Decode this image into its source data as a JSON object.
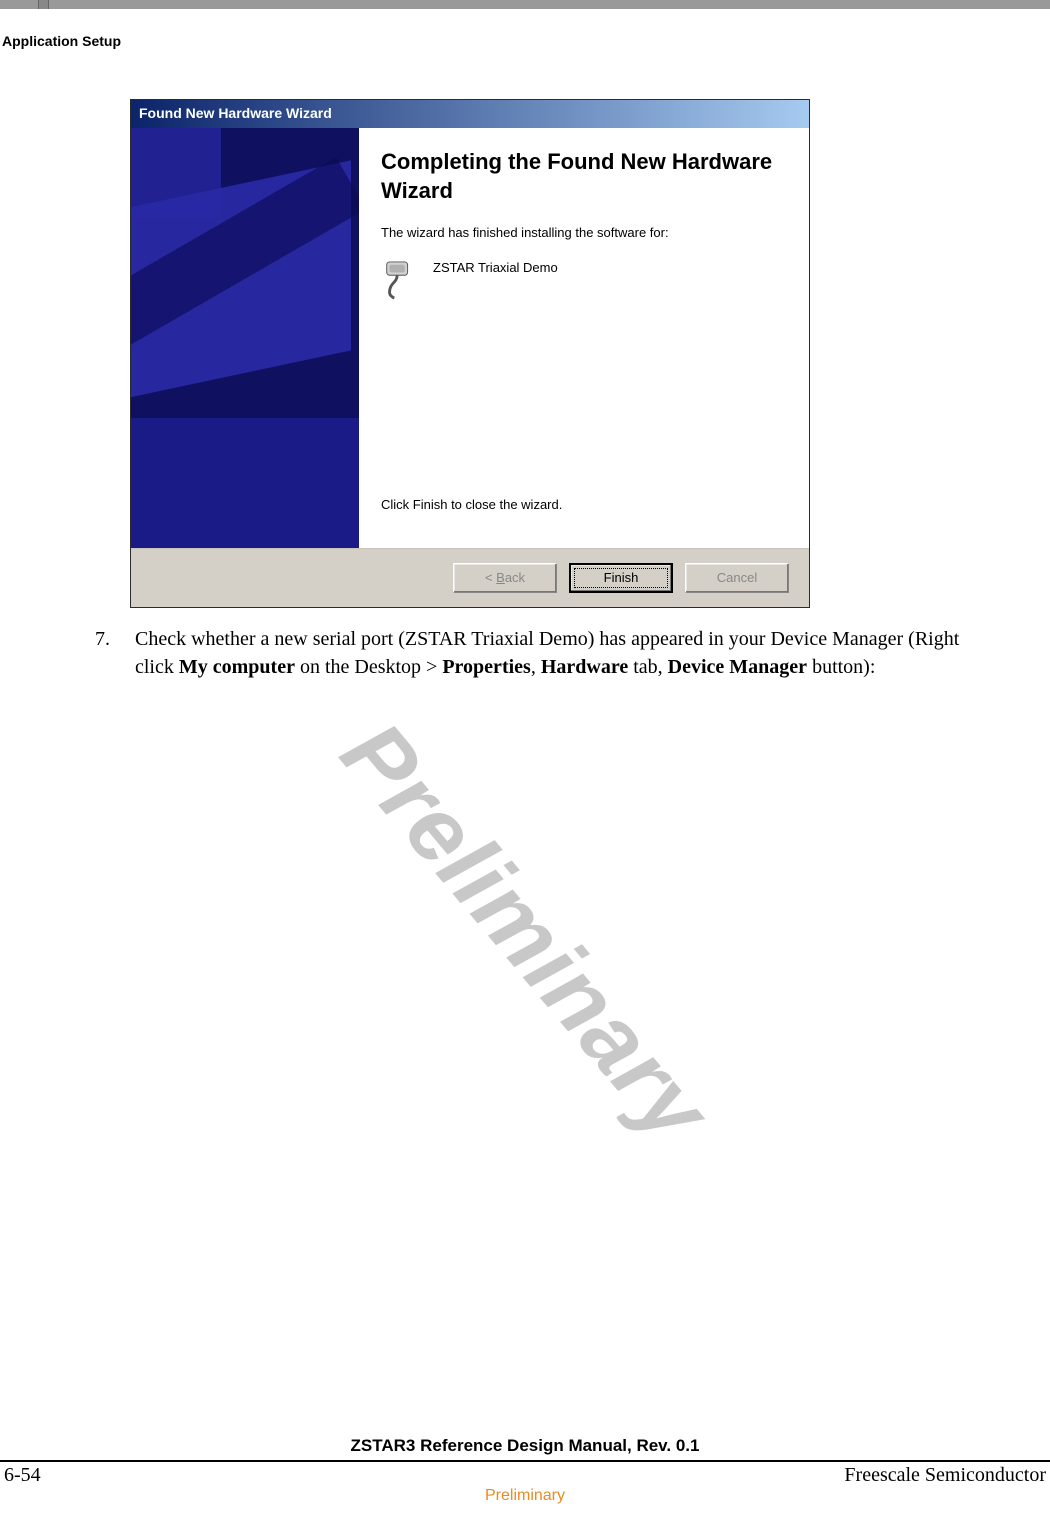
{
  "header": {
    "section_title": "Application Setup"
  },
  "dialog": {
    "title": "Found New Hardware Wizard",
    "heading": "Completing the Found New Hardware Wizard",
    "body_intro": "The wizard has finished installing the software for:",
    "device_name": "ZSTAR Triaxial Demo",
    "close_instruction": "Click Finish to close the wizard.",
    "buttons": {
      "back_full": "< Back",
      "back_underline_char": "B",
      "back_prefix": "< ",
      "back_rest": "ack",
      "finish": "Finish",
      "cancel": "Cancel"
    }
  },
  "step": {
    "number": "7.",
    "text_plain_1": "Check whether a new serial port (ZSTAR Triaxial Demo) has appeared in your Device Manager (Right click ",
    "bold_1": "My computer",
    "text_plain_2": " on the Desktop > ",
    "bold_2": "Properties",
    "text_plain_3": ", ",
    "bold_3": "Hardware",
    "text_plain_4": " tab, ",
    "bold_4": "Device Manager",
    "text_plain_5": " button):"
  },
  "watermark": "Preliminary",
  "footer": {
    "manual_title": "ZSTAR3 Reference Design Manual, Rev. 0.1",
    "page_number": "6-54",
    "company": "Freescale Semiconductor",
    "preliminary": "Preliminary"
  }
}
